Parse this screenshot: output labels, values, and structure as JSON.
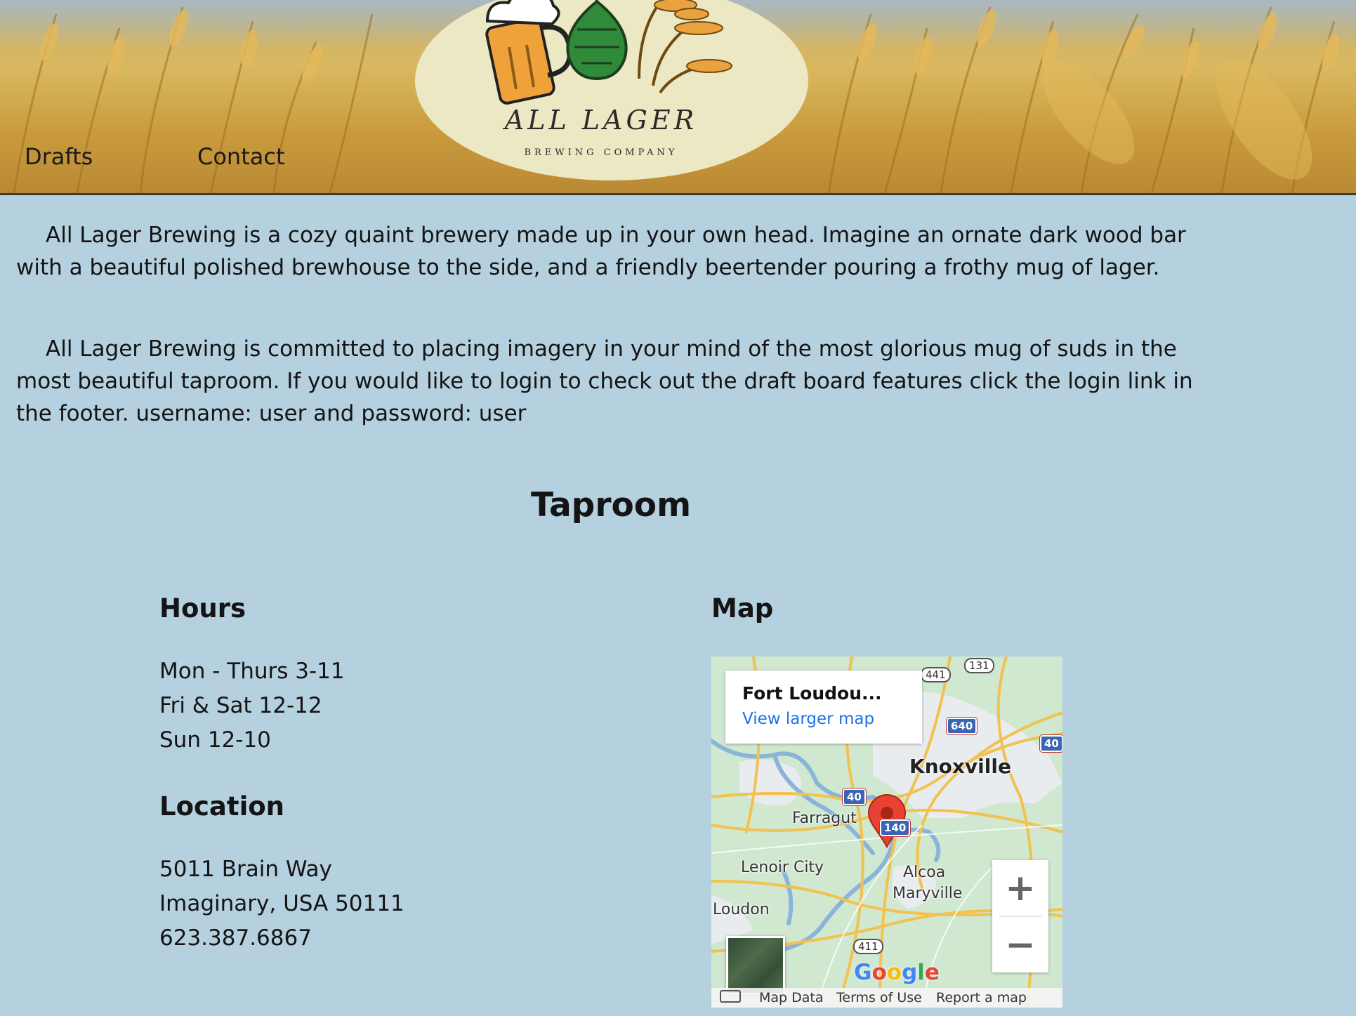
{
  "header": {
    "nav": [
      {
        "label": "Drafts"
      },
      {
        "label": "Contact"
      }
    ],
    "logo": {
      "name": "ALL LAGER",
      "tagline": "BREWING COMPANY"
    }
  },
  "intro": {
    "paragraphs": [
      "All Lager Brewing is a cozy quaint brewery made up in your own head. Imagine an ornate dark wood bar with a beautiful polished brewhouse to the side, and a friendly beertender pouring a frothy mug of lager.",
      "All Lager Brewing is committed to placing imagery in your mind of the most glorious mug of suds in the most beautiful taproom. If you would like to login to check out the draft board features click the login link in the footer. username: user and password: user"
    ]
  },
  "taproom": {
    "title": "Taproom",
    "hours": {
      "heading": "Hours",
      "lines": [
        "Mon - Thurs 3-11",
        "Fri & Sat 12-12",
        "Sun 12-10"
      ]
    },
    "location": {
      "heading": "Location",
      "lines": [
        "5011 Brain Way",
        "Imaginary, USA 50111",
        "623.387.6867"
      ]
    },
    "map": {
      "heading": "Map",
      "place_name": "Fort Loudou...",
      "view_larger": "View larger map",
      "labels": {
        "knoxville": "Knoxville",
        "farragut": "Farragut",
        "lenoir_city": "Lenoir City",
        "alcoa": "Alcoa",
        "maryville": "Maryville",
        "loudon": "Loudon"
      },
      "shields": [
        "441",
        "131",
        "640",
        "40",
        "40",
        "140",
        "411"
      ],
      "zoom_in": "+",
      "zoom_out": "−",
      "google": "Google",
      "footer": {
        "map_data": "Map Data",
        "terms": "Terms of Use",
        "report": "Report a map error"
      },
      "icons": [
        "map-pin-icon",
        "keyboard-icon"
      ]
    }
  }
}
